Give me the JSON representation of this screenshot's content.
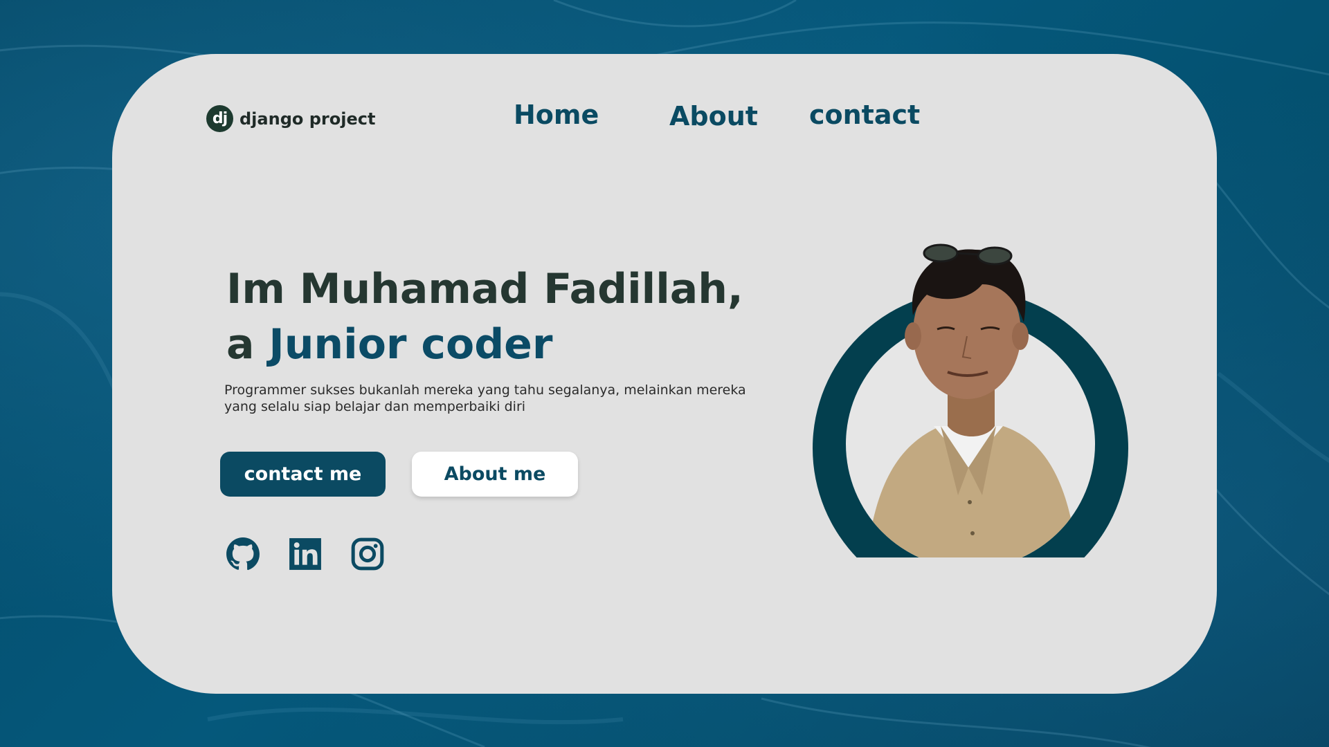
{
  "logo": {
    "mark": "dj",
    "text": "django project"
  },
  "nav": {
    "home": "Home",
    "about": "About",
    "contact": "contact"
  },
  "hero": {
    "title_line1": "Im Muhamad Fadillah,",
    "title_prefix": "a ",
    "title_accent": "Junior coder",
    "description": "Programmer sukses bukanlah mereka yang tahu segalanya, melainkan mereka yang selalu siap belajar dan memperbaiki diri"
  },
  "buttons": {
    "primary": "contact me",
    "secondary": "About me"
  },
  "socials": [
    "github-icon",
    "linkedin-icon",
    "instagram-icon"
  ],
  "colors": {
    "accent": "#0b4a62",
    "card": "#e1e1e1",
    "heading": "#253731",
    "ring": "#033f4e"
  }
}
